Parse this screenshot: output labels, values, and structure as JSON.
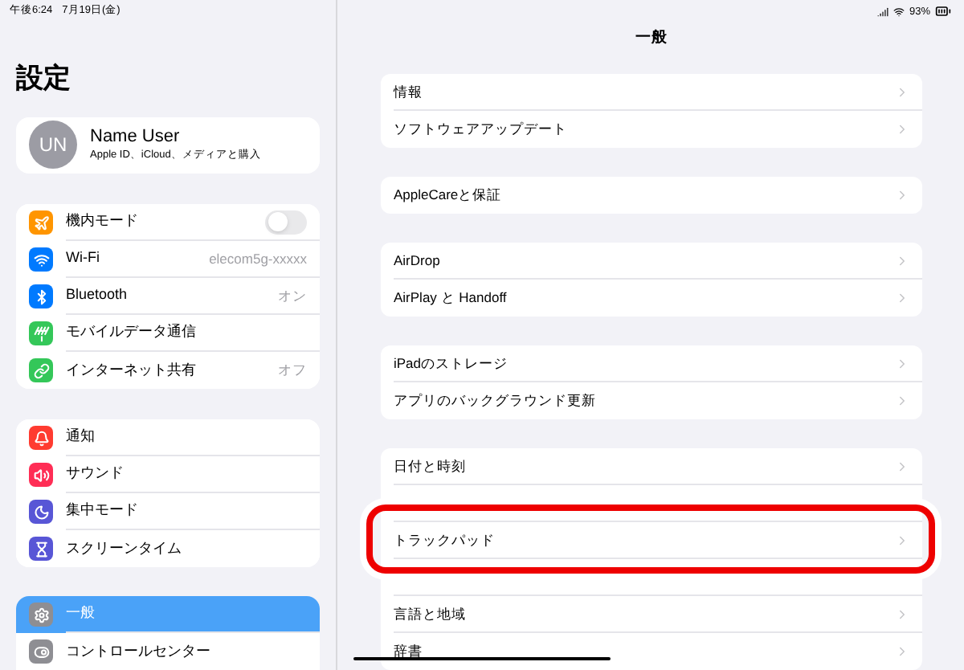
{
  "status_bar": {
    "time": "午後6:24",
    "date": "7月19日(金)",
    "battery": "93%"
  },
  "sidebar": {
    "title": "設定",
    "profile": {
      "initials": "UN",
      "name": "Name User",
      "subtitle": "Apple ID、iCloud、メディアと購入"
    },
    "groups": [
      [
        {
          "label": "機内モード",
          "kind": "toggle",
          "on": false,
          "selected": false,
          "color": "#ff9500"
        },
        {
          "label": "Wi-Fi",
          "kind": "value",
          "value": "elecom5g-xxxxx",
          "selected": false,
          "color": "#007aff"
        },
        {
          "label": "Bluetooth",
          "kind": "value",
          "value": "オン",
          "selected": false,
          "color": "#007aff"
        },
        {
          "label": "モバイルデータ通信",
          "kind": "plain",
          "selected": false,
          "color": "#34c759"
        },
        {
          "label": "インターネット共有",
          "kind": "value",
          "value": "オフ",
          "selected": false,
          "color": "#34c759"
        }
      ],
      [
        {
          "label": "通知",
          "kind": "plain",
          "selected": false,
          "color": "#ff3b30"
        },
        {
          "label": "サウンド",
          "kind": "plain",
          "selected": false,
          "color": "#ff2d55"
        },
        {
          "label": "集中モード",
          "kind": "plain",
          "selected": false,
          "color": "#5856d6"
        },
        {
          "label": "スクリーンタイム",
          "kind": "plain",
          "selected": false,
          "color": "#5856d6"
        }
      ],
      [
        {
          "label": "一般",
          "kind": "plain",
          "selected": true,
          "color": "#8e8e93"
        },
        {
          "label": "コントロールセンター",
          "kind": "plain",
          "selected": false,
          "color": "#8e8e93"
        }
      ]
    ]
  },
  "detail": {
    "title": "一般",
    "groups": [
      [
        {
          "kind": "text",
          "label": "情報",
          "highlighted": false
        },
        {
          "kind": "text",
          "label": "ソフトウェアアップデート",
          "highlighted": false
        }
      ],
      [
        {
          "kind": "text",
          "label": "AppleCareと保証",
          "highlighted": false
        }
      ],
      [
        {
          "kind": "text",
          "label": "AirDrop",
          "highlighted": false
        },
        {
          "kind": "text",
          "label": "AirPlay と Handoff",
          "highlighted": false
        }
      ],
      [
        {
          "kind": "text",
          "label": "iPadのストレージ",
          "highlighted": false
        },
        {
          "kind": "text",
          "label": "アプリのバックグラウンド更新",
          "highlighted": false
        }
      ],
      [
        {
          "kind": "text",
          "label": "日付と時刻",
          "highlighted": false
        },
        {
          "kind": "blank",
          "highlighted": false
        },
        {
          "kind": "text",
          "label": "トラックパッド",
          "highlighted": true
        },
        {
          "kind": "blank",
          "highlighted": false
        },
        {
          "kind": "text",
          "label": "言語と地域",
          "highlighted": false
        },
        {
          "kind": "text",
          "label": "辞書",
          "highlighted": false
        }
      ]
    ]
  }
}
